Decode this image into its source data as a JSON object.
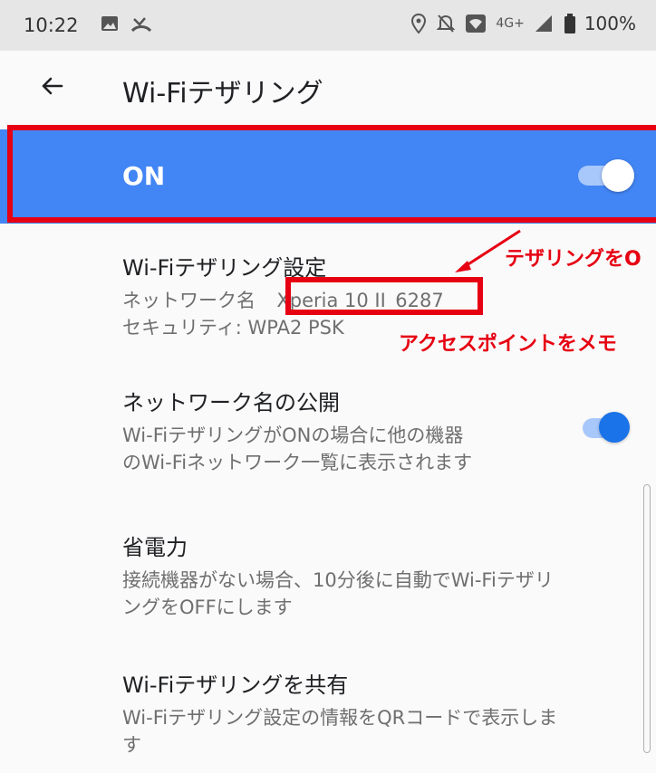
{
  "status_bar": {
    "time": "10:22",
    "network": "4G+",
    "battery": "100%"
  },
  "appbar": {
    "title": "Wi-Fiテザリング",
    "back_icon": "arrow-back-icon"
  },
  "master_switch": {
    "label": "ON",
    "state": "on"
  },
  "annotations": {
    "tether_note": "テザリングをO",
    "ap_note": "アクセスポイントをメモ"
  },
  "settings": {
    "tethering_config": {
      "title": "Wi-Fiテザリング設定",
      "network_prefix": "ネットワーク名",
      "network_name": "Xperia 10 II_6287",
      "security": "セキュリティ: WPA2 PSK"
    },
    "broadcast_name": {
      "title": "ネットワーク名の公開",
      "line1": "Wi-FiテザリングがONの場合に他の機器",
      "line2": "のWi-Fiネットワーク一覧に表示されます",
      "state": "on"
    },
    "power_saving": {
      "title": "省電力",
      "line1": "接続機器がない場合、10分後に自動でWi-Fiテザリ",
      "line2": "ングをOFFにします"
    },
    "share": {
      "title": "Wi-Fiテザリングを共有",
      "line1": "Wi-Fiテザリング設定の情報をQRコードで表示しま",
      "line2": "す"
    }
  },
  "colors": {
    "accent": "#4285f4",
    "switch_on": "#1a73e8",
    "highlight": "#e60012"
  }
}
